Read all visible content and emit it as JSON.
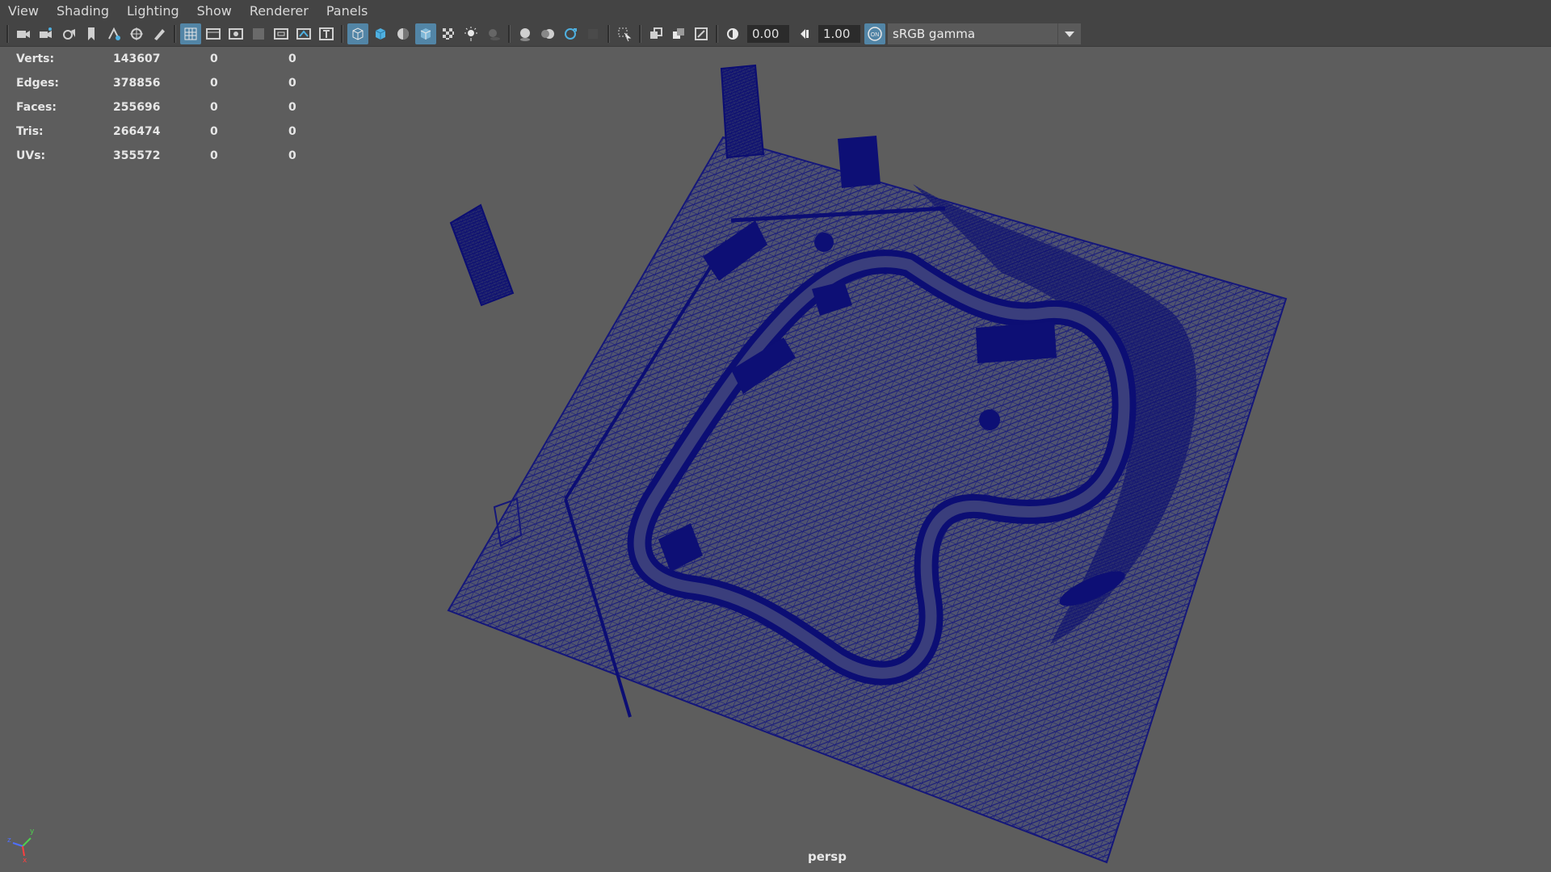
{
  "menu": [
    "View",
    "Shading",
    "Lighting",
    "Show",
    "Renderer",
    "Panels"
  ],
  "toolbar": {
    "exposure_value": "0.00",
    "gamma_value": "1.00",
    "color_management_toggle": "ON",
    "colorspace_value": "sRGB gamma",
    "icons": [
      "select-camera-icon",
      "camera-attributes-icon",
      "bookmarks-icon",
      "image-plane-icon",
      "two-d-pan-zoom-icon",
      "grease-pencil-icon",
      "grid-icon",
      "film-gate-icon",
      "resolution-gate-icon",
      "gate-mask-icon",
      "field-chart-icon",
      "safe-action-icon",
      "safe-title-icon",
      "wireframe-icon",
      "smooth-shade-icon",
      "use-default-material-icon",
      "wireframe-on-shaded-icon",
      "textured-icon",
      "use-all-lights-icon",
      "shadows-icon",
      "screen-space-ao-icon",
      "motion-blur-icon",
      "multisample-aa-icon",
      "depth-of-field-icon",
      "isolate-select-icon",
      "xray-icon",
      "xray-active-components-icon",
      "xray-joints-icon",
      "exposure-icon",
      "gamma-icon",
      "color-management-icon"
    ]
  },
  "hud": {
    "rows": [
      {
        "label": "Verts:",
        "v1": "143607",
        "v2": "0",
        "v3": "0"
      },
      {
        "label": "Edges:",
        "v1": "378856",
        "v2": "0",
        "v3": "0"
      },
      {
        "label": "Faces:",
        "v1": "255696",
        "v2": "0",
        "v3": "0"
      },
      {
        "label": "Tris:",
        "v1": "266474",
        "v2": "0",
        "v3": "0"
      },
      {
        "label": "UVs:",
        "v1": "355572",
        "v2": "0",
        "v3": "0"
      }
    ]
  },
  "viewport": {
    "camera_label": "persp",
    "wire_color": "#0f117a",
    "background_color": "#5d5d5d",
    "axis_labels": {
      "x": "x",
      "y": "y",
      "z": "z"
    }
  }
}
